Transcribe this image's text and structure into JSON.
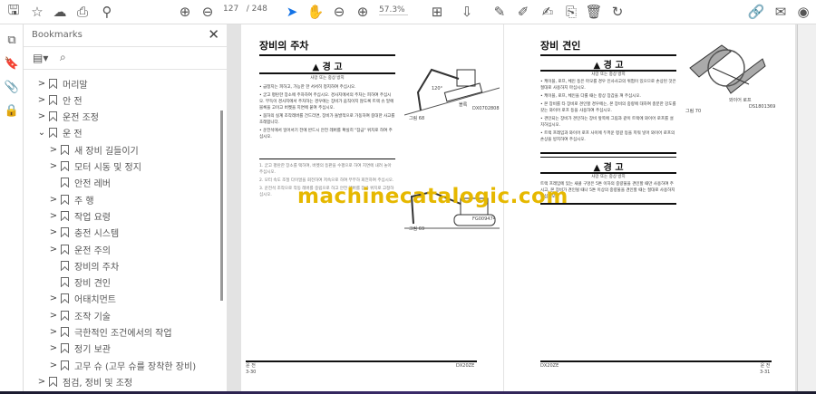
{
  "toolbar": {
    "current_page": "127",
    "total_pages": "/ 248",
    "zoom": "57.3%",
    "icons": [
      "save-icon",
      "star-icon",
      "cloud-upload-icon",
      "print-icon",
      "zoom-search-icon",
      "page-up-icon",
      "page-down-icon",
      "select-cursor-icon",
      "hand-icon",
      "zoom-out-icon",
      "zoom-in-icon",
      "fit-page-icon",
      "scroll-mode-icon",
      "comment-icon",
      "highlight-pen-icon",
      "sign-icon",
      "stamp-icon",
      "delete-icon",
      "rotate-icon",
      "share-link-icon",
      "email-icon",
      "account-icon"
    ]
  },
  "sidebar": {
    "title": "Bookmarks",
    "close": "✕",
    "items": [
      {
        "label": "머리말",
        "level": 0,
        "chev": ">"
      },
      {
        "label": "안 전",
        "level": 0,
        "chev": ">"
      },
      {
        "label": "운전 조정",
        "level": 0,
        "chev": ">"
      },
      {
        "label": "운 전",
        "level": 0,
        "chev": "⌄"
      },
      {
        "label": "새 장비 길들이기",
        "level": 1,
        "chev": ">"
      },
      {
        "label": "모터 시동 및 정지",
        "level": 1,
        "chev": ">"
      },
      {
        "label": "안전 레버",
        "level": 1,
        "chev": ""
      },
      {
        "label": "주 행",
        "level": 1,
        "chev": ">"
      },
      {
        "label": "작업 요령",
        "level": 1,
        "chev": ">"
      },
      {
        "label": "충전 시스템",
        "level": 1,
        "chev": ">"
      },
      {
        "label": "운전 주의",
        "level": 1,
        "chev": ">"
      },
      {
        "label": "장비의 주차",
        "level": 1,
        "chev": ""
      },
      {
        "label": "장비 견인",
        "level": 1,
        "chev": ""
      },
      {
        "label": "어태치먼트",
        "level": 1,
        "chev": ">"
      },
      {
        "label": "조작 기술",
        "level": 1,
        "chev": ">"
      },
      {
        "label": "극한적인 조건에서의 작업",
        "level": 1,
        "chev": ">"
      },
      {
        "label": "정기 보관",
        "level": 1,
        "chev": ">"
      },
      {
        "label": "고무 슈 (고무 슈를 장착한 장비)",
        "level": 1,
        "chev": ">"
      },
      {
        "label": "점검, 정비 및 조정",
        "level": 0,
        "chev": ">"
      }
    ]
  },
  "left_page": {
    "title": "장비의 주차",
    "warning": "경 고",
    "warn_sub": "사망 또는 중상 방지",
    "bullets": [
      "• 급정지는 피하고, 가능한 한 서서히 정지하여 주십시오.",
      "• 굳고 평탄한 장소에 주차하여 주십시오. 경사지에서의 주차는 피하여 주십시오. 부득이 경사지에서 주차하는 경우에는 장비가 움직이지 않도록 트랙 슈 밑에 블록을 고이고 버켓을 지면에 붙여 주십시오.",
      "• 붐하의 실계 조작레버를 건드리면, 장비가 돌발적으로 가동하여 중대한 사고를 초래합니다.",
      "• 운전석에서 일어서기 전에 반드시 안전 레버를 확실히 \"잠금\" 위치로 하여 주십시오."
    ],
    "steps": [
      "1. 굳고 평탄한 장소를 택하여, 버켓의 등판을 수평으로 하여 지면에 내려 놓아 주십시오.",
      "2. 모터 속도 조절 다이얼을 회전하여 저속으로 하여 무부하 회전하여 주십시오.",
      "3. 운전석 조작으로 작동 레버를 중립으로 하고 안전 레버를 잠금 위치로 고정하십시오."
    ],
    "fig68": "그림 68",
    "fig68_code": "DX0702808",
    "angle": "120°",
    "block": "블록",
    "fig69": "그림 69",
    "fig69_code": "FG009474",
    "footer_section": "운 전",
    "footer_page": "3-30",
    "footer_model": "DX20ZE"
  },
  "right_page": {
    "title": "장비 견인",
    "warning": "경 고",
    "warn_sub": "사망 또는 중상 방지",
    "bullets": [
      "• 케이블, 로프, 체인 등은 마모를 경우 인사사고의 위험이 있으므로 손상된 것은 절대로 사용하지 마십시오.",
      "• 케이블, 로프, 체인을 다룰 때는 항상 장갑을 껴 주십시오.",
      "• 본 장비를 타 장비로 견인할 경우에는, 본 장비의 중량에 대하여 충분한 강도를 갖는 와이어 로프 등을 사용하여 주십시오.",
      "• 견인되는 장비가 견인하는 장비 앞쪽에 그림과 같이 트랙에 와이어 로프를 설치하십시오.",
      "• 트랙 프레임과 와이어 로프 사이에 두꺼운 헝겊 등을 끼워 넣어 와이어 로프의 손상을 방지하여 주십시오."
    ],
    "warning2": "경 고",
    "warn2_sub": "사망 또는 중상 방지",
    "warn2_text": "트랙 프레임에 있는 새클 구멍은 5톤 이하의 중량물을 견인할 때만 사용하여 주시고, 본 장비가 견인될 때나 5톤 이상의 중량물을 견인할 때는 절대로 사용하지 마십시오.",
    "fig70": "그림 70",
    "fig70_code": "DS1801369",
    "wire": "와이어 로프",
    "footer_model": "DX20ZE",
    "footer_section": "운 전",
    "footer_page": "3-31"
  },
  "watermark": "machinecatalogic.com"
}
